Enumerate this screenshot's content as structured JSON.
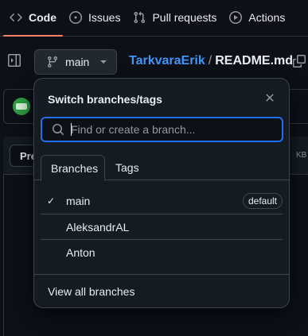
{
  "nav": {
    "tabs": [
      {
        "label": "Code",
        "icon": "code-icon",
        "selected": true
      },
      {
        "label": "Issues",
        "icon": "issue-opened-icon",
        "selected": false
      },
      {
        "label": "Pull requests",
        "icon": "git-pull-request-icon",
        "selected": false
      },
      {
        "label": "Actions",
        "icon": "play-icon",
        "selected": false
      }
    ]
  },
  "file_header": {
    "branch": "main",
    "owner": "TarkvaraErik",
    "separator": "/",
    "file": "README.md"
  },
  "background": {
    "preview_label": "Pre",
    "size_fragment": "KB"
  },
  "dropdown": {
    "title": "Switch branches/tags",
    "search_placeholder": "Find or create a branch...",
    "tabs": [
      "Branches",
      "Tags"
    ],
    "branches": [
      {
        "name": "main",
        "checked": true,
        "badge": "default"
      },
      {
        "name": "AleksandrAL",
        "checked": false,
        "badge": ""
      },
      {
        "name": "Anton",
        "checked": false,
        "badge": ""
      }
    ],
    "check_glyph": "✓",
    "footer_link": "View all branches"
  },
  "colors": {
    "background": "#0d1117",
    "overlay": "#151b23",
    "accent_link": "#4493f8",
    "focus_ring": "#1f6feb",
    "selected_tab_underline": "#f78166"
  }
}
